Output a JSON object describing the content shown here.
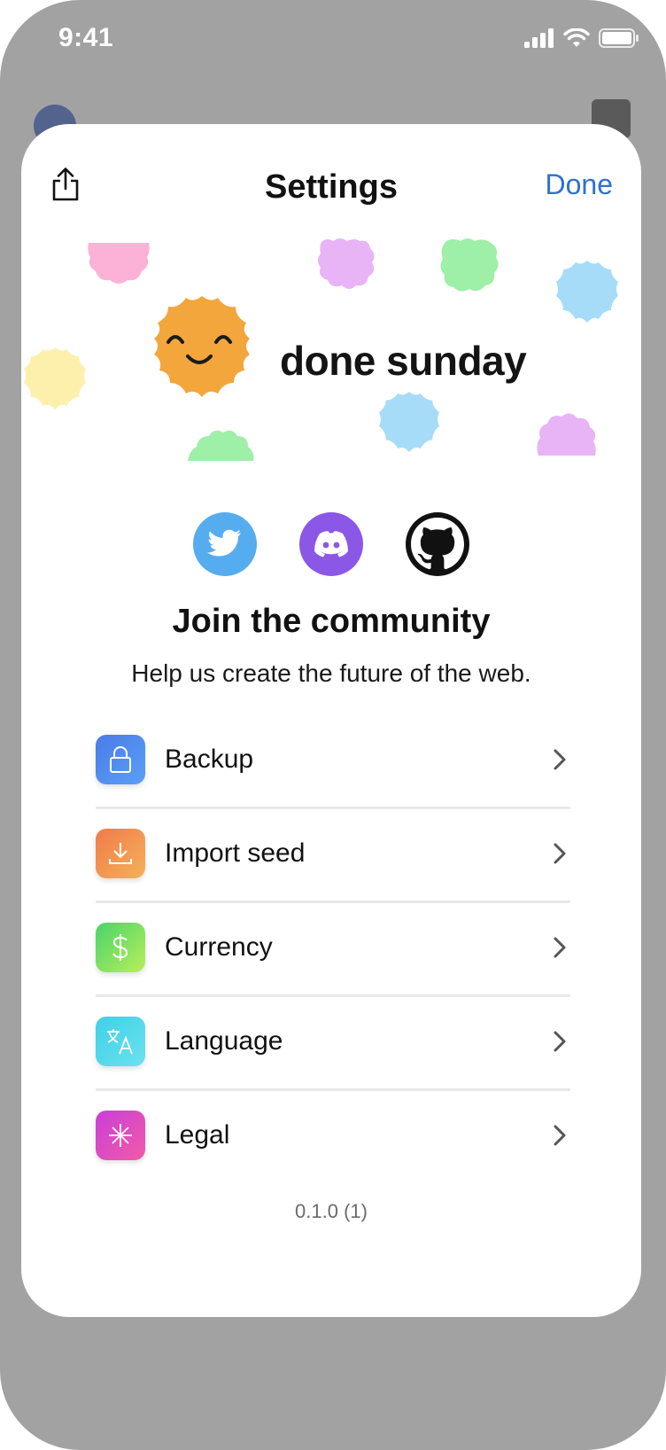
{
  "status_bar": {
    "time": "9:41"
  },
  "header": {
    "title": "Settings",
    "done_label": "Done"
  },
  "brand": {
    "name": "done sunday"
  },
  "community": {
    "title": "Join the community",
    "subtitle": "Help us create the future of the web.",
    "links": [
      {
        "name": "twitter",
        "icon": "twitter-icon",
        "color": "#55acee"
      },
      {
        "name": "discord",
        "icon": "discord-icon",
        "color": "#8b57e6"
      },
      {
        "name": "github",
        "icon": "github-icon",
        "color": "#111111"
      }
    ]
  },
  "menu": {
    "items": [
      {
        "label": "Backup",
        "icon": "lock-icon",
        "colors": [
          "#4a7be8",
          "#5aa0f5"
        ]
      },
      {
        "label": "Import seed",
        "icon": "download-icon",
        "colors": [
          "#f07a4a",
          "#f4b25a"
        ]
      },
      {
        "label": "Currency",
        "icon": "dollar-icon",
        "colors": [
          "#4ad36a",
          "#b8ef5a"
        ]
      },
      {
        "label": "Language",
        "icon": "translate-icon",
        "colors": [
          "#3fd0e6",
          "#6ae2f0"
        ]
      },
      {
        "label": "Legal",
        "icon": "asterisk-icon",
        "colors": [
          "#c83fd8",
          "#f25aa8"
        ]
      }
    ]
  },
  "footer": {
    "version": "0.1.0 (1)"
  },
  "colors": {
    "accent": "#2f6fd8",
    "sheet": "#ffffff",
    "backdrop": "#a2a2a2",
    "mascot": "#f2a63c"
  }
}
